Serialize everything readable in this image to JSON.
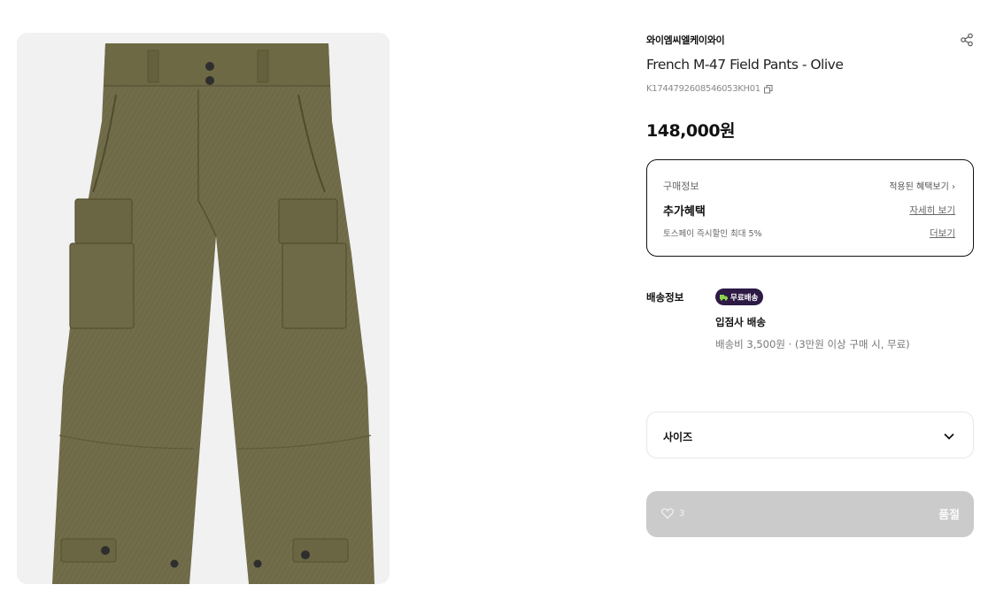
{
  "product": {
    "brand": "와이엠씨엘케이와이",
    "title": "French M-47 Field Pants - Olive",
    "code": "K1744792608546053KH01",
    "price": "148,000원",
    "image_icon": "olive-cargo-pants-photo"
  },
  "benefits": {
    "label": "구매정보",
    "applied_link": "적용된 혜택보기 ›",
    "title": "추가혜택",
    "detail_link": "자세히 보기",
    "sub": "토스페이 즉시할인 최대 5%",
    "more_link": "더보기"
  },
  "shipping": {
    "label": "배송정보",
    "badge": "무료배송",
    "method": "입점사 배송",
    "fee": "배송비 3,500원 · (3만원 이상 구매 시, 무료)"
  },
  "size_select": {
    "label": "사이즈",
    "icon": "chevron-down-icon"
  },
  "buy_bar": {
    "wish_count": "3",
    "status": "품절"
  },
  "colors": {
    "badge_bg": "#2d1a45",
    "disabled_bar": "#cbcbcb",
    "olive": "#6f6c4a"
  }
}
